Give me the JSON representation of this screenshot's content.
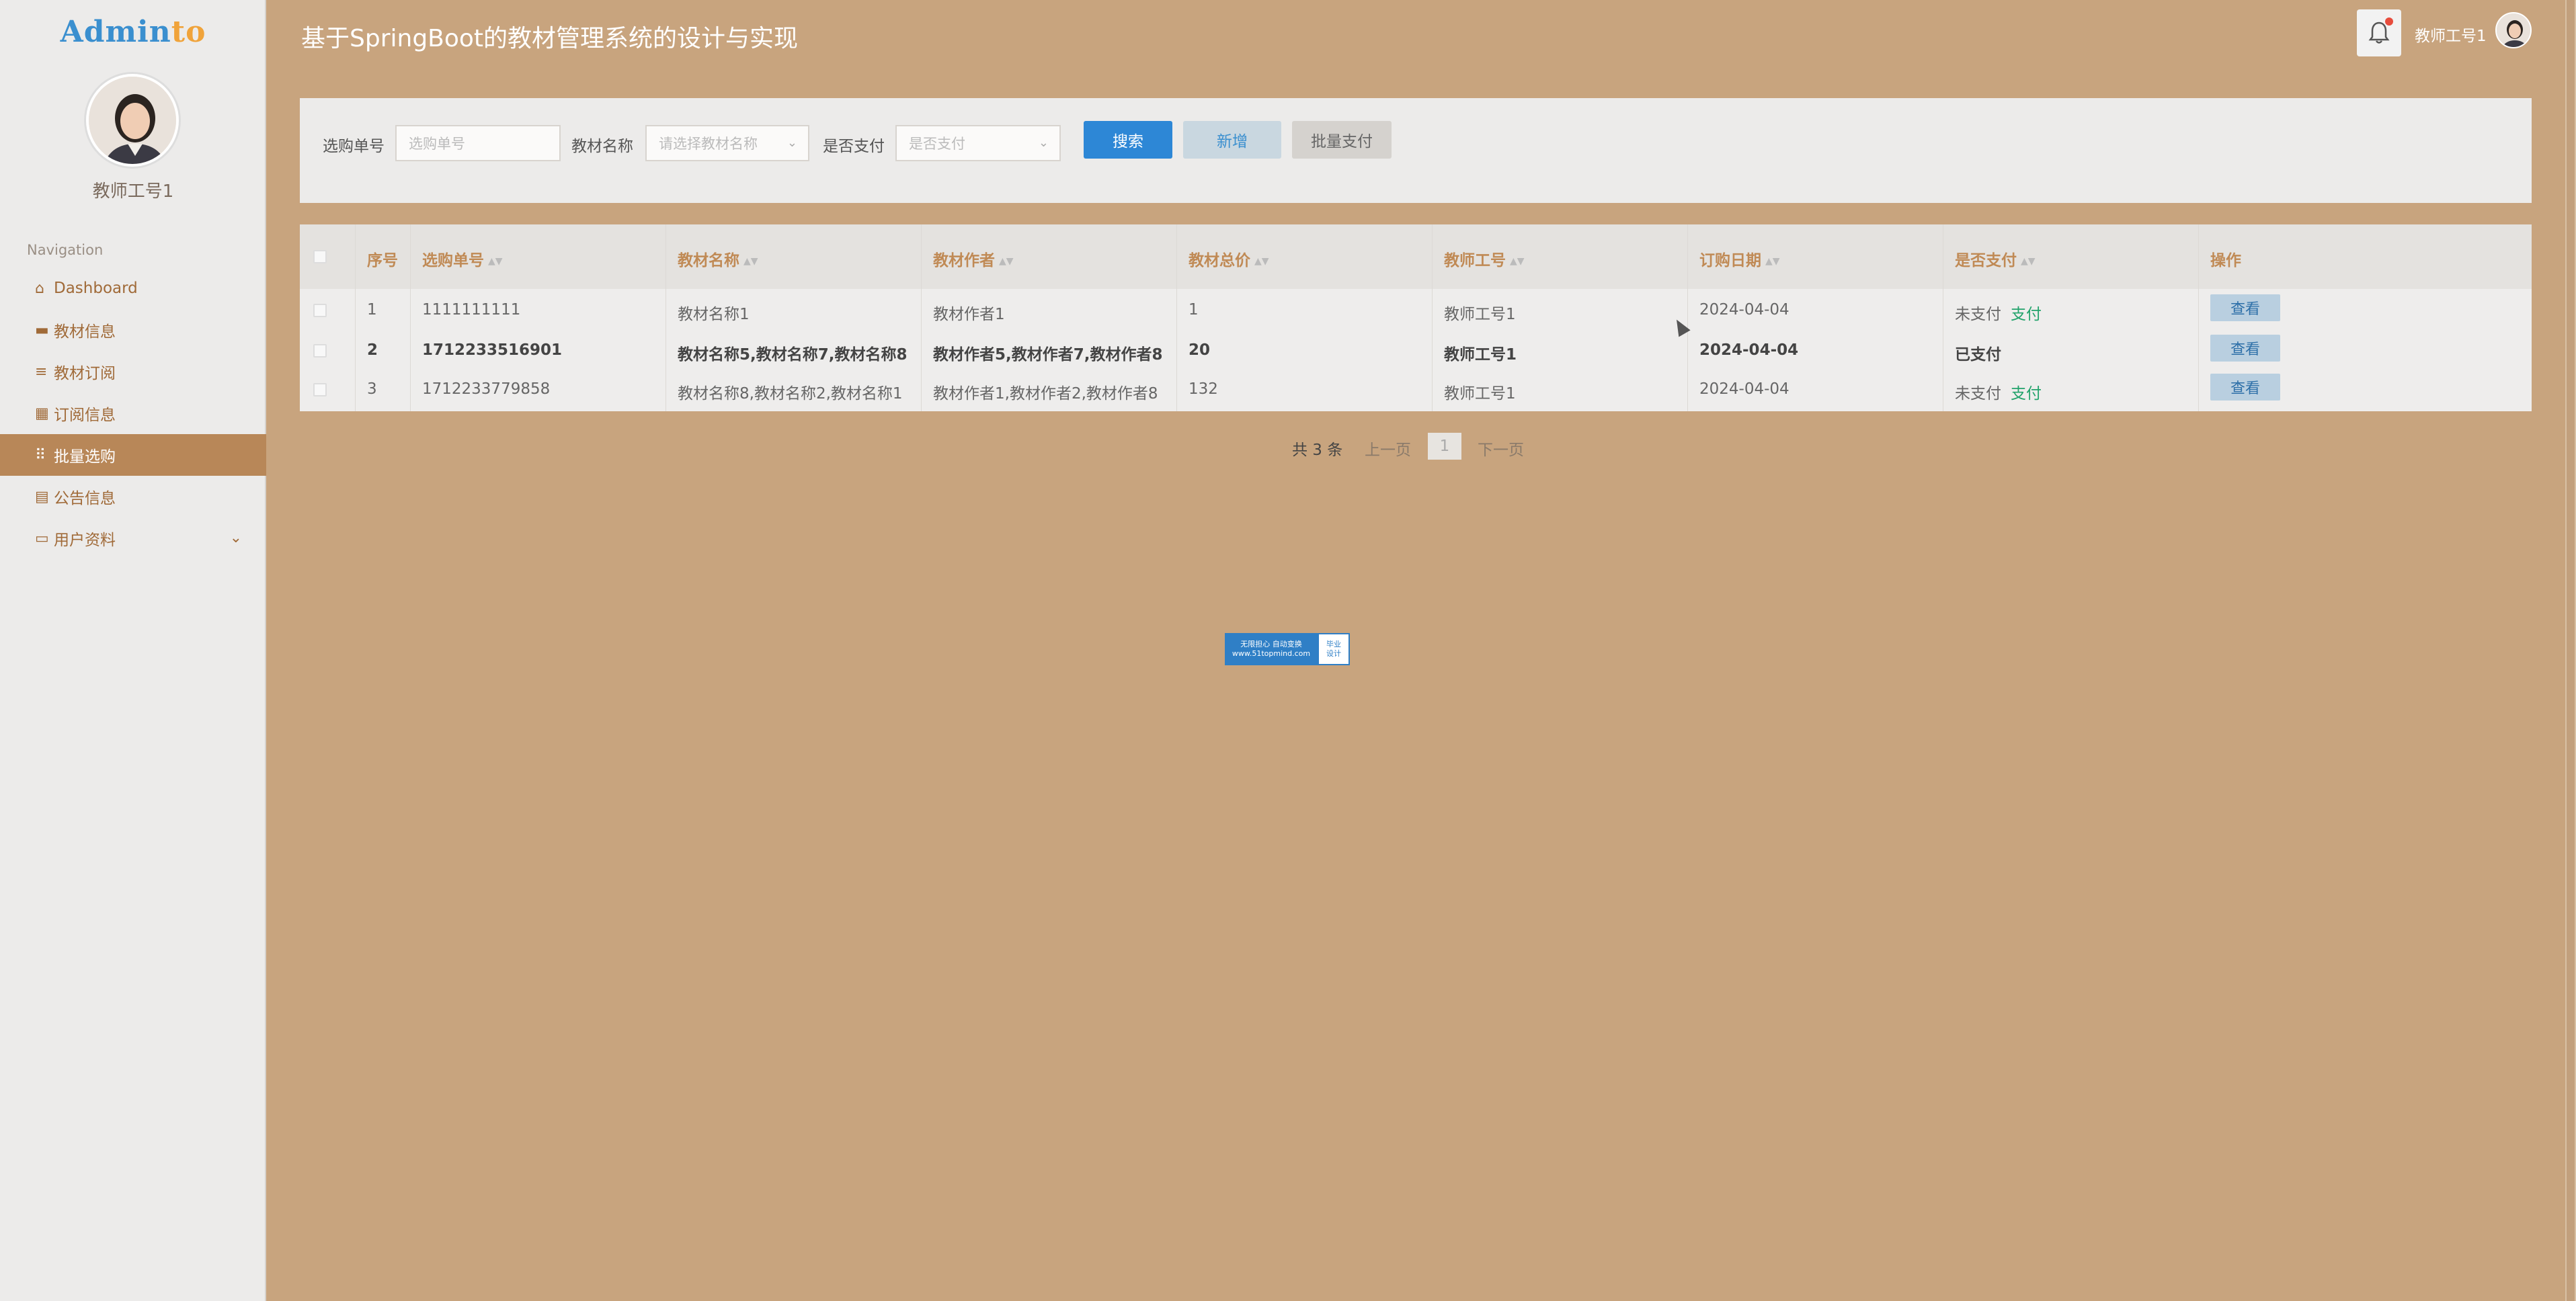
{
  "sidebar": {
    "logo_part1": "Admin",
    "logo_part2": "to",
    "user_name": "教师工号1",
    "nav_title": "Navigation",
    "items": [
      {
        "label": "Dashboard",
        "icon": "home-icon"
      },
      {
        "label": "教材信息",
        "icon": "book-icon"
      },
      {
        "label": "教材订阅",
        "icon": "list-icon"
      },
      {
        "label": "订阅信息",
        "icon": "grid-icon"
      },
      {
        "label": "批量选购",
        "icon": "apps-icon"
      },
      {
        "label": "公告信息",
        "icon": "clipboard-icon"
      },
      {
        "label": "用户资料",
        "icon": "card-icon"
      }
    ]
  },
  "header": {
    "title": "基于SpringBoot的教材管理系统的设计与实现",
    "user": "教师工号1"
  },
  "search": {
    "order_label": "选购单号",
    "order_placeholder": "选购单号",
    "name_label": "教材名称",
    "name_placeholder": "请选择教材名称",
    "paid_label": "是否支付",
    "paid_placeholder": "是否支付",
    "search_btn": "搜索",
    "add_btn": "新增",
    "batch_pay_btn": "批量支付"
  },
  "table": {
    "headers": [
      "序号",
      "选购单号",
      "教材名称",
      "教材作者",
      "教材总价",
      "教师工号",
      "订购日期",
      "是否支付",
      "操作"
    ],
    "rows": [
      {
        "no": "1",
        "order": "1111111111",
        "name": "教材名称1",
        "author": "教材作者1",
        "total": "1",
        "teacher": "教师工号1",
        "date": "2024-04-04",
        "paid": "未支付",
        "pay_link": "支付",
        "action": "查看"
      },
      {
        "no": "2",
        "order": "1712233516901",
        "name": "教材名称5,教材名称7,教材名称8",
        "author": "教材作者5,教材作者7,教材作者8",
        "total": "20",
        "teacher": "教师工号1",
        "date": "2024-04-04",
        "paid": "已支付",
        "pay_link": "",
        "action": "查看"
      },
      {
        "no": "3",
        "order": "1712233779858",
        "name": "教材名称8,教材名称2,教材名称1",
        "author": "教材作者1,教材作者2,教材作者8",
        "total": "132",
        "teacher": "教师工号1",
        "date": "2024-04-04",
        "paid": "未支付",
        "pay_link": "支付",
        "action": "查看"
      }
    ]
  },
  "pagination": {
    "total": "共 3 条",
    "prev": "上一页",
    "current": "1",
    "next": "下一页"
  },
  "watermark": {
    "line1": "无限担心 自动变换",
    "line2": "www.51topmind.com",
    "badge1": "毕业",
    "badge2": "设计"
  },
  "colors": {
    "background": "#c8a47e",
    "sidebar_active": "#b88758",
    "primary": "#2d87d6",
    "pay_link": "#22a36b"
  }
}
